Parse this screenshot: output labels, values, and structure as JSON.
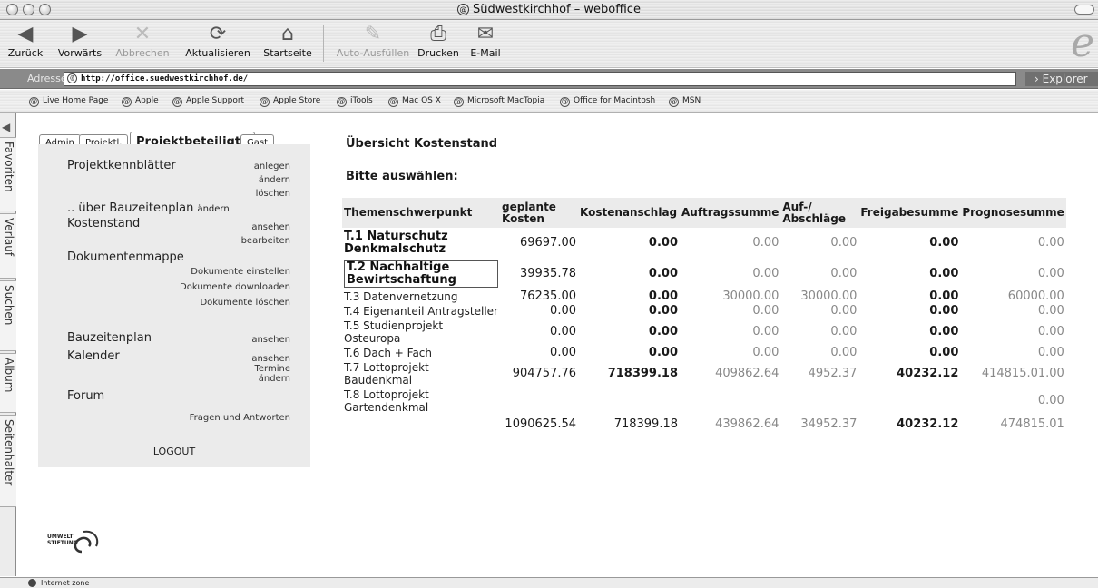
{
  "window": {
    "title": "Südwestkirchhof – weboffice"
  },
  "toolbar": {
    "buttons": [
      {
        "label": "Zurück",
        "icon": "back-arrow-icon"
      },
      {
        "label": "Vorwärts",
        "icon": "forward-arrow-icon"
      },
      {
        "label": "Abbrechen",
        "icon": "stop-x-icon"
      },
      {
        "label": "Aktualisieren",
        "icon": "refresh-icon"
      },
      {
        "label": "Startseite",
        "icon": "home-icon"
      },
      {
        "label": "Auto-Ausfüllen",
        "icon": "autofill-icon"
      },
      {
        "label": "Drucken",
        "icon": "printer-icon"
      },
      {
        "label": "E-Mail",
        "icon": "mail-icon"
      }
    ]
  },
  "address": {
    "label": "Adresse:",
    "url": "http://office.suedwestkirchhof.de/",
    "go_label": "Explorer"
  },
  "favorites": [
    "Live Home Page",
    "Apple",
    "Apple Support",
    "Apple Store",
    "iTools",
    "Mac OS X",
    "Microsoft MacTopia",
    "Office for Macintosh",
    "MSN"
  ],
  "sidebar": {
    "tabs": [
      "Favoriten",
      "Verlauf",
      "Suchen",
      "Album",
      "Seitenhalter"
    ]
  },
  "nav": {
    "tabs": [
      "Admin",
      "Projektl.",
      "Projektbeteiligte",
      "Gast"
    ],
    "projektkennblaetter": {
      "title": "Projektkennblätter",
      "actions": [
        "anlegen",
        "ändern",
        "löschen"
      ]
    },
    "bauzeitenplan_link": {
      "title": ".. über Bauzeitenplan",
      "suffix": "ändern"
    },
    "kostenstand": {
      "title": "Kostenstand",
      "actions": [
        "ansehen",
        "bearbeiten"
      ]
    },
    "dokumentenmappe": {
      "title": "Dokumentenmappe",
      "actions": [
        "Dokumente einstellen",
        "Dokumente downloaden",
        "Dokumente löschen"
      ]
    },
    "bauzeitenplan": {
      "title": "Bauzeitenplan",
      "actions": [
        "ansehen"
      ]
    },
    "kalender": {
      "title": "Kalender",
      "actions": [
        "ansehen",
        "Termine",
        "ändern"
      ]
    },
    "forum": {
      "title": "Forum",
      "actions": [
        "Fragen und Antworten"
      ]
    },
    "logout": "LOGOUT"
  },
  "logo": {
    "line1": "UMWELT",
    "line2": "STIFTUNG"
  },
  "main": {
    "title": "Übersicht Kostenstand",
    "subtitle": "Bitte auswählen:",
    "columns": [
      "Themenschwerpunkt",
      "geplante Kosten",
      "Kostenanschlag",
      "Auftragssumme",
      "Auf-/ Abschläge",
      "Freigabesumme",
      "Prognosesumme"
    ],
    "rows": [
      {
        "topic": "T.1 Naturschutz Denkmalschutz",
        "geplant": "69697.00",
        "anschlag": "0.00",
        "auftrag": "0.00",
        "aufab": "0.00",
        "freigabe": "0.00",
        "prognose": "0.00"
      },
      {
        "topic": "T.2 Nachhaltige Bewirtschaftung",
        "geplant": "39935.78",
        "anschlag": "0.00",
        "auftrag": "0.00",
        "aufab": "0.00",
        "freigabe": "0.00",
        "prognose": "0.00"
      },
      {
        "topic": "T.3 Datenvernetzung",
        "geplant": "76235.00",
        "anschlag": "0.00",
        "auftrag": "30000.00",
        "aufab": "30000.00",
        "freigabe": "0.00",
        "prognose": "60000.00"
      },
      {
        "topic": "T.4 Eigenanteil Antragsteller",
        "geplant": "0.00",
        "anschlag": "0.00",
        "auftrag": "0.00",
        "aufab": "0.00",
        "freigabe": "0.00",
        "prognose": "0.00"
      },
      {
        "topic": "T.5 Studienprojekt Osteuropa",
        "geplant": "0.00",
        "anschlag": "0.00",
        "auftrag": "0.00",
        "aufab": "0.00",
        "freigabe": "0.00",
        "prognose": "0.00"
      },
      {
        "topic": "T.6 Dach + Fach",
        "geplant": "0.00",
        "anschlag": "0.00",
        "auftrag": "0.00",
        "aufab": "0.00",
        "freigabe": "0.00",
        "prognose": "0.00"
      },
      {
        "topic": "T.7 Lottoprojekt Baudenkmal",
        "geplant": "904757.76",
        "anschlag": "718399.18",
        "auftrag": "409862.64",
        "aufab": "4952.37",
        "freigabe": "40232.12",
        "prognose": "414815.01.00"
      },
      {
        "topic": "T.8 Lottoprojekt Gartendenkmal",
        "geplant": "",
        "anschlag": "",
        "auftrag": "",
        "aufab": "",
        "freigabe": "",
        "prognose": "0.00"
      }
    ],
    "totals": {
      "geplant": "1090625.54",
      "anschlag": "718399.18",
      "auftrag": "439862.64",
      "aufab": "34952.37",
      "freigabe": "40232.12",
      "prognose": "474815.01"
    }
  },
  "status": {
    "zone": "Internet zone"
  }
}
